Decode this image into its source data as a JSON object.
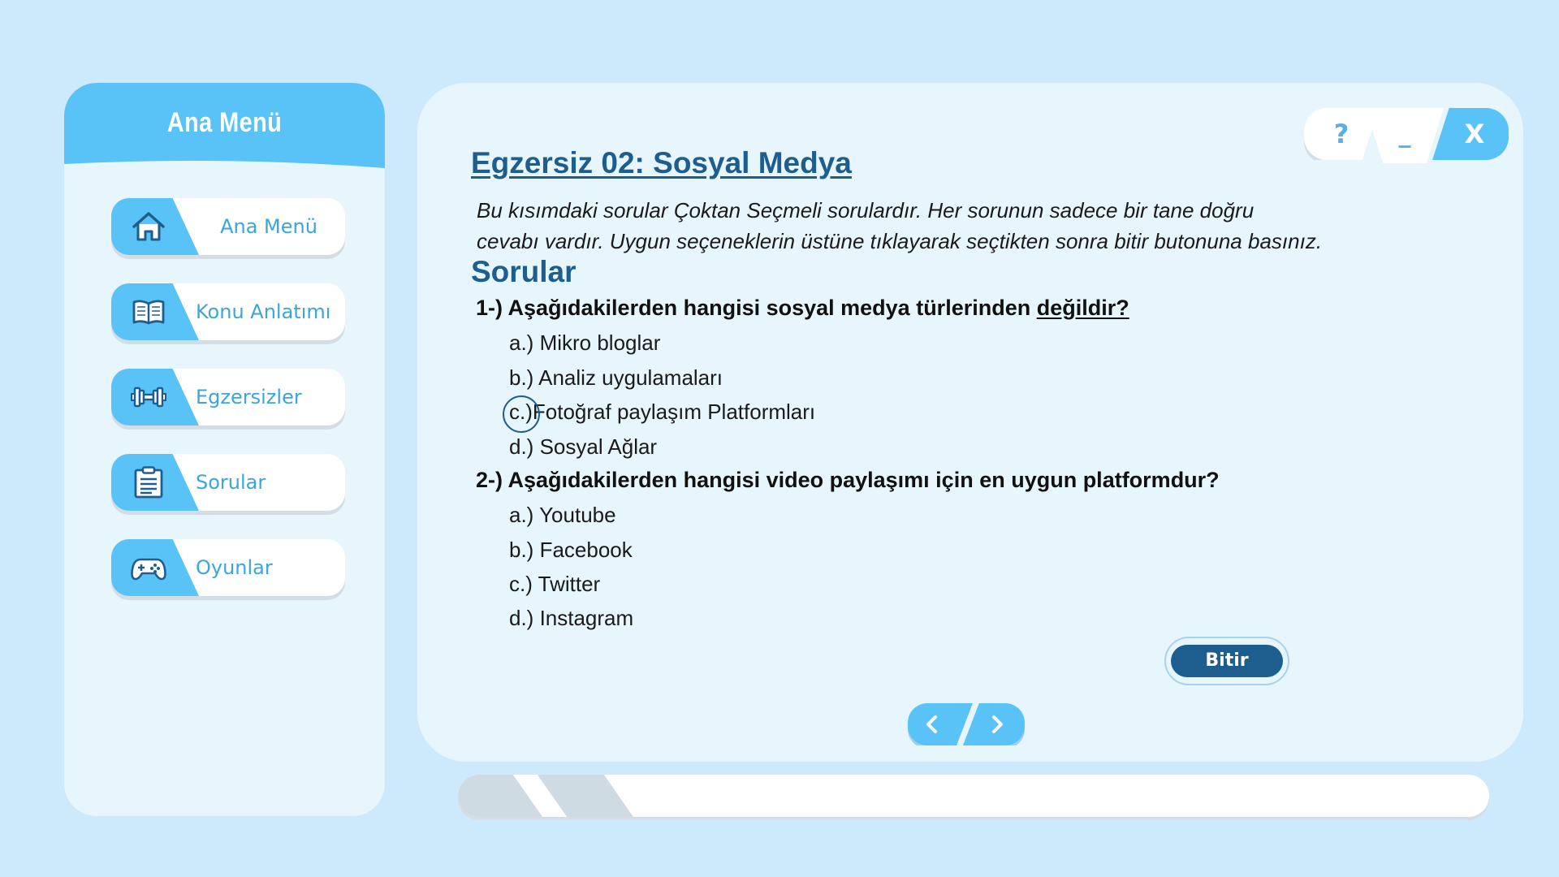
{
  "sidebar": {
    "title": "Ana Menü",
    "items": [
      {
        "label": "Ana Menü",
        "icon": "home-icon"
      },
      {
        "label": "Konu Anlatımı",
        "icon": "book-icon"
      },
      {
        "label": "Egzersizler",
        "icon": "dumbbell-icon"
      },
      {
        "label": "Sorular",
        "icon": "clipboard-icon"
      },
      {
        "label": "Oyunlar",
        "icon": "gamepad-icon"
      }
    ]
  },
  "window_controls": {
    "help": "?",
    "minimize": "_",
    "close": "X"
  },
  "main": {
    "title": "Egzersiz 02: Sosyal Medya",
    "instructions_line1": "Bu kısımdaki sorular Çoktan Seçmeli sorulardır. Her sorunun sadece bir tane doğru",
    "instructions_line2": "cevabı vardır. Uygun seçeneklerin üstüne tıklayarak seçtikten sonra bitir butonuna basınız.",
    "section_title": "Sorular",
    "questions": [
      {
        "prefix": "1-) Aşağıdakilerden hangisi sosyal medya türlerinden ",
        "emphasis": "değildir?",
        "selected": "c",
        "options": [
          {
            "letter": "a.)",
            "text": " Mikro bloglar"
          },
          {
            "letter": "b.)",
            "text": " Analiz uygulamaları"
          },
          {
            "letter": "c.)",
            "text": "Fotoğraf paylaşım Platformları"
          },
          {
            "letter": "d.)",
            "text": " Sosyal Ağlar"
          }
        ]
      },
      {
        "prefix": "2-) Aşağıdakilerden hangisi video paylaşımı için en uygun platformdur?",
        "emphasis": "",
        "selected": "",
        "options": [
          {
            "letter": "a.)",
            "text": " Youtube"
          },
          {
            "letter": "b.)",
            "text": " Facebook"
          },
          {
            "letter": "c.)",
            "text": " Twitter"
          },
          {
            "letter": "d.)",
            "text": " Instagram"
          }
        ]
      }
    ],
    "finish_button": "Bitir"
  },
  "progress": {
    "value": 0.17
  },
  "colors": {
    "background": "#cdeafd",
    "panel": "#e7f5fd",
    "accent": "#59c2f6",
    "title": "#1e5e8f",
    "nav_text": "#3aa5de"
  }
}
